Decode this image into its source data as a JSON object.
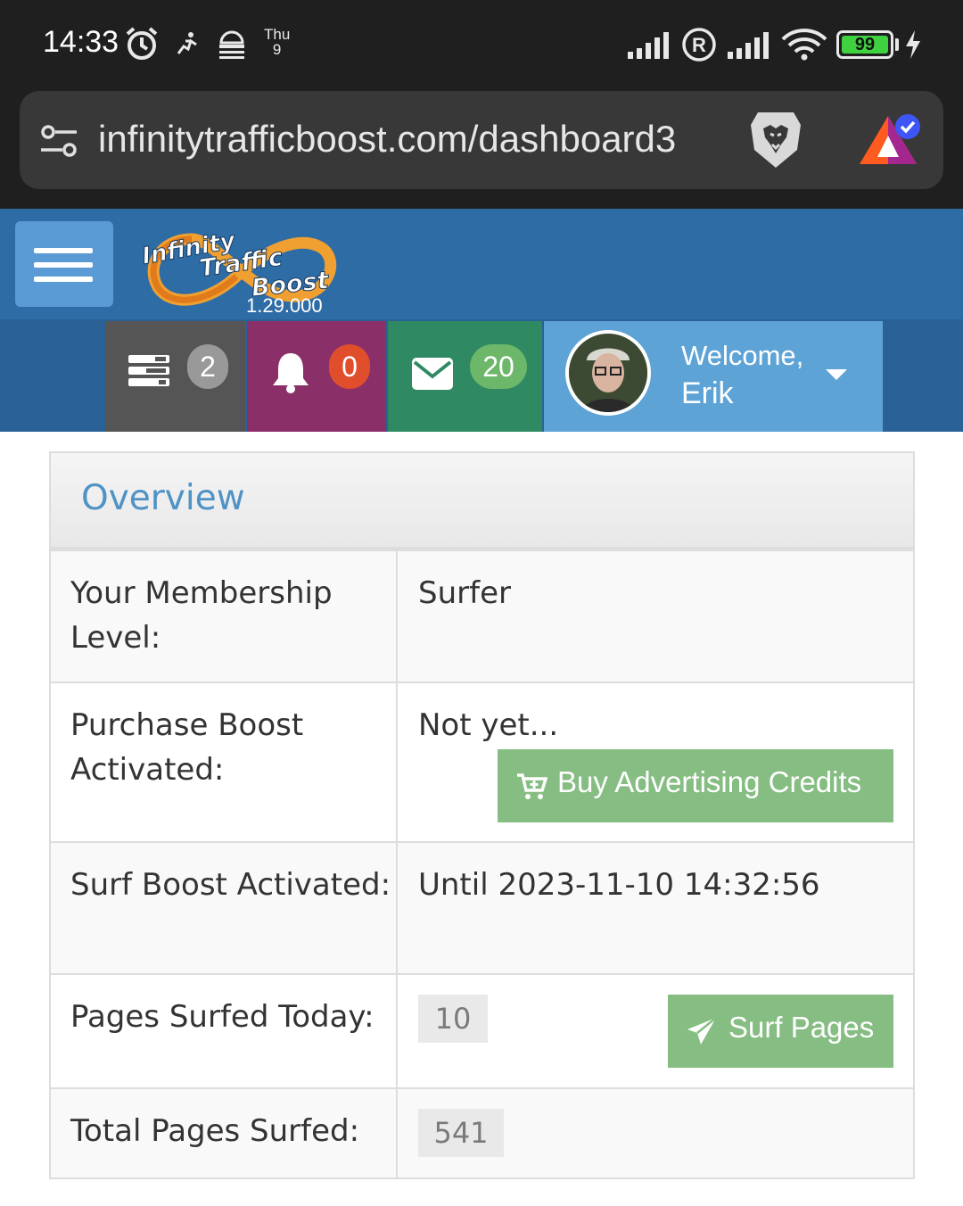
{
  "status_bar": {
    "time": "14:33",
    "day": "Thu",
    "date": "9",
    "battery": "99",
    "icons": [
      "alarm-icon",
      "activity-icon",
      "news-icon",
      "signal-icon",
      "registered-icon",
      "signal-icon",
      "wifi-icon",
      "battery-icon",
      "charging-icon"
    ]
  },
  "browser": {
    "url": "infinitytrafficboost.com/dashboard3",
    "icons": [
      "site-settings-icon",
      "brave-shields-icon",
      "brave-rewards-icon"
    ]
  },
  "header": {
    "version": "1.29.000",
    "logo_text": [
      "Infinity",
      "Traffic",
      "Boost"
    ]
  },
  "nav": {
    "tasks_count": "2",
    "notifications_count": "0",
    "messages_count": "20",
    "welcome_line1": "Welcome,",
    "welcome_name": "Erik",
    "colors": {
      "tasks_bg": "#555555",
      "notifications_bg": "#8b2f69",
      "messages_bg": "#2f8a63",
      "user_bg": "#5ea3d6"
    }
  },
  "overview": {
    "title": "Overview",
    "rows": [
      {
        "label": "Your Membership Level:",
        "value": "Surfer"
      },
      {
        "label": "Purchase Boost Activated:",
        "value": "Not yet...",
        "button": "Buy Advertising Credits"
      },
      {
        "label": "Surf Boost Activated:",
        "value": "Until 2023-11-10 14:32:56"
      },
      {
        "label": "Pages Surfed Today:",
        "value": "10",
        "button": "Surf Pages"
      },
      {
        "label": "Total Pages Surfed:",
        "value": "541"
      }
    ]
  }
}
